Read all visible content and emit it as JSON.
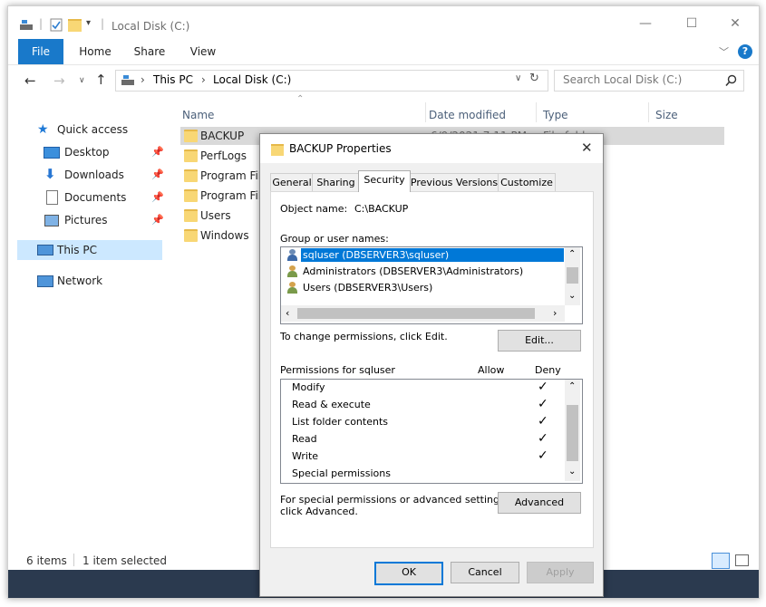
{
  "window": {
    "title": "Local Disk (C:)",
    "controls": {
      "minimize": "—",
      "maximize": "☐",
      "close": "✕"
    }
  },
  "ribbon": {
    "tabs": [
      "File",
      "Home",
      "Share",
      "View"
    ],
    "expand_icon": "chevron-down-icon",
    "help": "?"
  },
  "address": {
    "path": [
      "This PC",
      "Local Disk (C:)"
    ],
    "search_placeholder": "Search Local Disk (C:)"
  },
  "nav": {
    "quick_access": "Quick access",
    "items": [
      {
        "label": "Desktop",
        "pinned": true
      },
      {
        "label": "Downloads",
        "pinned": true
      },
      {
        "label": "Documents",
        "pinned": true
      },
      {
        "label": "Pictures",
        "pinned": true
      }
    ],
    "this_pc": "This PC",
    "network": "Network"
  },
  "files": {
    "columns": {
      "name": "Name",
      "date": "Date modified",
      "type": "Type",
      "size": "Size"
    },
    "rows": [
      {
        "name": "BACKUP",
        "date": "6/9/2021 7:11 PM",
        "type": "File folder"
      },
      {
        "name": "PerfLogs"
      },
      {
        "name": "Program Fil"
      },
      {
        "name": "Program Fil"
      },
      {
        "name": "Users"
      },
      {
        "name": "Windows"
      }
    ]
  },
  "status": {
    "count": "6 items",
    "selected": "1 item selected"
  },
  "dialog": {
    "title": "BACKUP Properties",
    "tabs": [
      "General",
      "Sharing",
      "Security",
      "Previous Versions",
      "Customize"
    ],
    "object_label": "Object name:",
    "object_value": "C:\\BACKUP",
    "group_label": "Group or user names:",
    "users": [
      "sqluser (DBSERVER3\\sqluser)",
      "Administrators (DBSERVER3\\Administrators)",
      "Users (DBSERVER3\\Users)"
    ],
    "change_text": "To change permissions, click Edit.",
    "edit_button": "Edit...",
    "perm_header": "Permissions for sqluser",
    "allow": "Allow",
    "deny": "Deny",
    "permissions": [
      {
        "name": "Modify",
        "deny": true
      },
      {
        "name": "Read & execute",
        "deny": true
      },
      {
        "name": "List folder contents",
        "deny": true
      },
      {
        "name": "Read",
        "deny": true
      },
      {
        "name": "Write",
        "deny": true
      },
      {
        "name": "Special permissions",
        "deny": false
      }
    ],
    "special_text_1": "For special permissions or advanced settings,",
    "special_text_2": "click Advanced.",
    "advanced_button": "Advanced",
    "ok": "OK",
    "cancel": "Cancel",
    "apply": "Apply"
  }
}
